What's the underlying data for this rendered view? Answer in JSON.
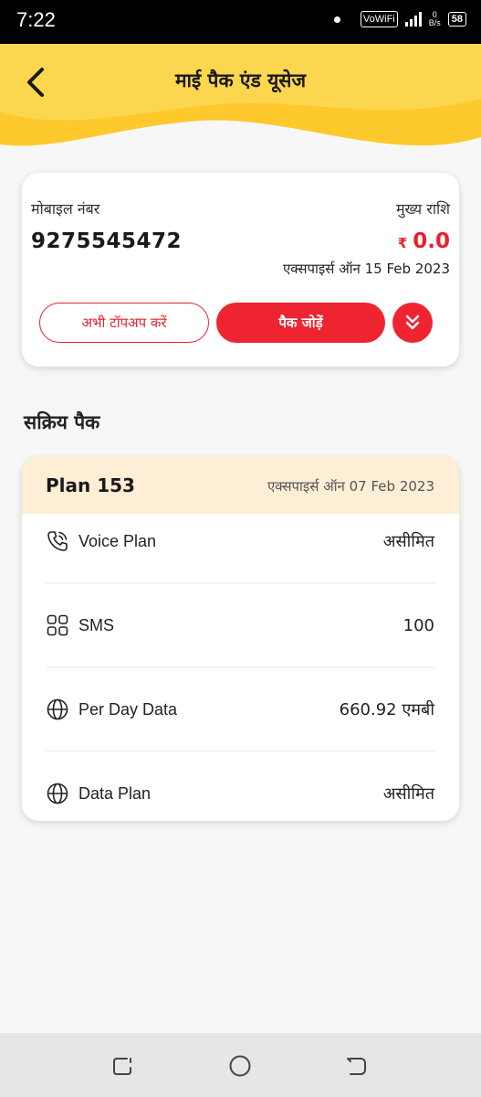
{
  "status_bar": {
    "time": "7:22",
    "network_label": "VoWiFi",
    "speed_value": "0",
    "speed_unit": "B/s",
    "battery": "58"
  },
  "header": {
    "title": "माई पैक एंड यूसेज",
    "back_icon": "chevron-left-icon",
    "bg_color": "#fdd24a"
  },
  "balance_card": {
    "mobile_label": "मोबाइल नंबर",
    "mobile_number": "9275545472",
    "balance_label": "मुख्य राशि",
    "currency_symbol": "₹",
    "balance_value": "0.0",
    "expiry_text": "एक्सपाइर्स ऑन 15 Feb 2023",
    "topup_label": "अभी टॉपअप करें",
    "add_pack_label": "पैक जोड़ें",
    "expand_icon": "double-chevron-down-icon",
    "accent_color": "#ee2530"
  },
  "active_packs": {
    "section_title": "सक्रिय पैक",
    "plan": {
      "name": "Plan 153",
      "expiry_text": "एक्सपाइर्स ऑन 07 Feb 2023",
      "rows": [
        {
          "icon": "phone-call-icon",
          "label": "Voice Plan",
          "value": "असीमित"
        },
        {
          "icon": "grid-icon",
          "label": "SMS",
          "value": "100"
        },
        {
          "icon": "globe-icon",
          "label": "Per Day Data",
          "value": "660.92 एमबी"
        },
        {
          "icon": "globe-icon",
          "label": "Data Plan",
          "value": "असीमित"
        }
      ]
    }
  },
  "nav_bar": {
    "recent_icon": "recent-apps-icon",
    "home_icon": "home-circle-icon",
    "back_icon": "back-nav-icon"
  }
}
